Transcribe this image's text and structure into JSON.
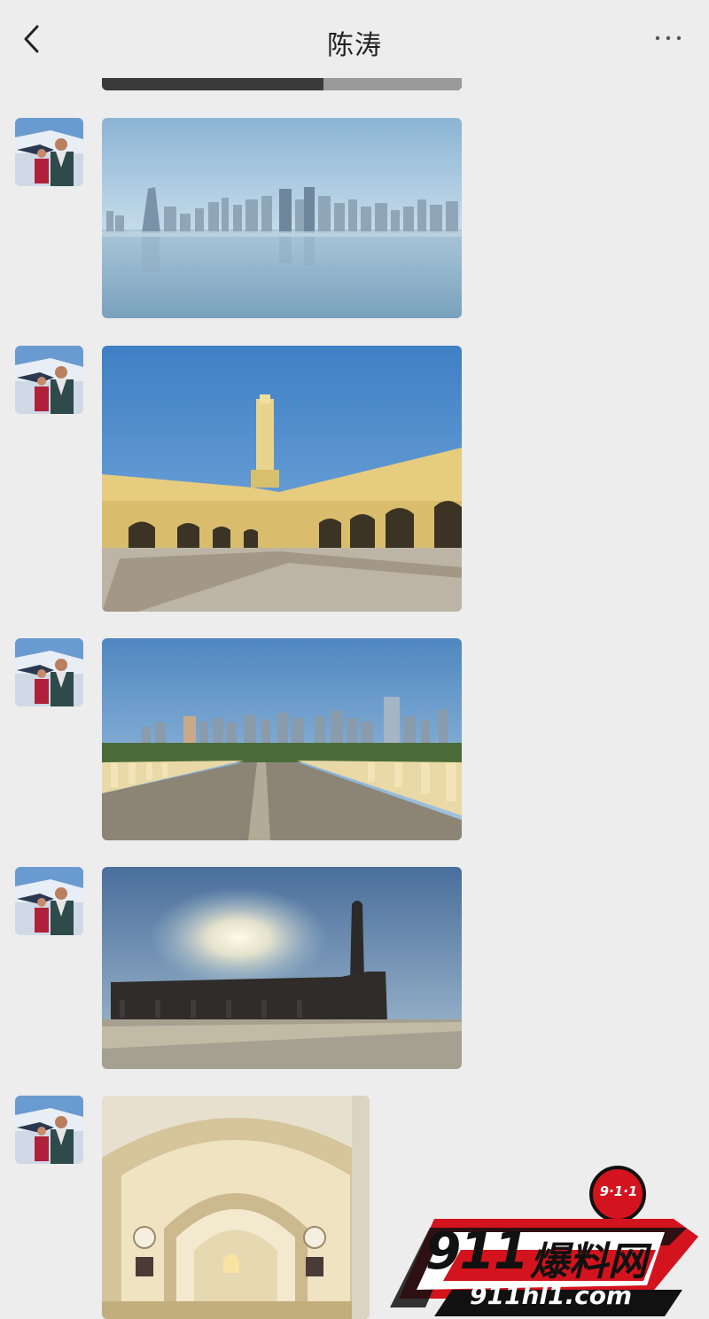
{
  "header": {
    "title": "陈涛",
    "back_icon": "chevron-left-icon",
    "more_icon": "more-dots-icon"
  },
  "messages": [
    {
      "sender": "avatar",
      "content": "photo",
      "subject": "doha-skyline-waterfront"
    },
    {
      "sender": "avatar",
      "content": "photo",
      "subject": "mosque-courtyard-minaret"
    },
    {
      "sender": "avatar",
      "content": "photo",
      "subject": "promenade-city-skyline"
    },
    {
      "sender": "avatar",
      "content": "photo",
      "subject": "mosque-silhouette-sun"
    },
    {
      "sender": "avatar",
      "content": "photo",
      "subject": "mosque-arch-interior"
    }
  ],
  "watermark": {
    "badge": "9·1·1",
    "main_number": "911",
    "main_text": "爆料网",
    "url": "911hl1.com"
  },
  "colors": {
    "background": "#ededed",
    "accent_red": "#d3131e"
  }
}
